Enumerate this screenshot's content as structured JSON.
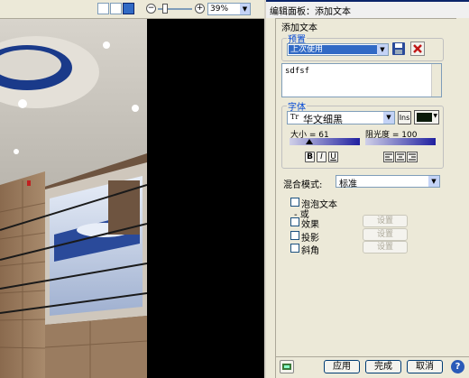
{
  "toolbar": {
    "zoom_value": "39%",
    "zoom_minus": "−",
    "zoom_plus": "+"
  },
  "panel": {
    "title": "编辑面板：添加文本",
    "section_title": "添加文本",
    "preset": {
      "legend": "预置",
      "selected": "上次使用"
    },
    "text_value": "sdfsf",
    "font": {
      "legend": "字体",
      "family": "华文细黑",
      "family_icon_text": "Tr",
      "ins_label": "Ins",
      "size_label": "大小 = 61",
      "opacity_label": "阻光度 = 100",
      "bold": "B",
      "italic": "I",
      "underline": "U"
    },
    "blend": {
      "label": "混合模式:",
      "selected": "标准"
    },
    "options": {
      "bubble_text": "泡泡文本",
      "or_label": "- 或",
      "effects": "效果",
      "shadow": "投影",
      "bevel": "斜角",
      "settings": "设置"
    },
    "footer": {
      "apply": "应用",
      "done": "完成",
      "cancel": "取消",
      "help": "?"
    }
  },
  "colors": {
    "accent": "#316ac5",
    "select_bg": "#316ac5",
    "panel_bg": "#ece9d8",
    "swatch": "#0a1a0a"
  }
}
